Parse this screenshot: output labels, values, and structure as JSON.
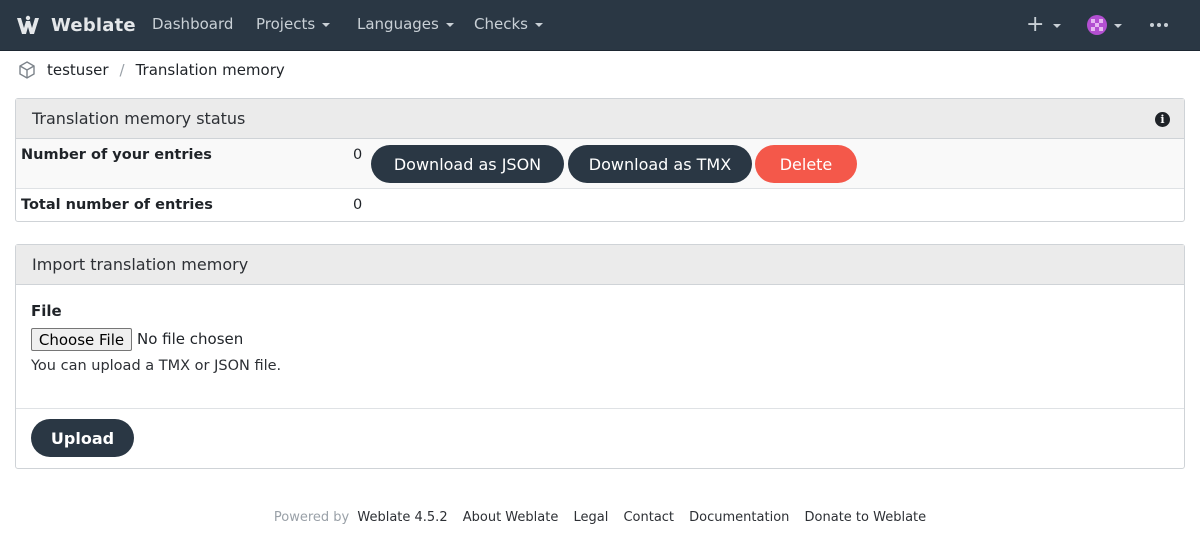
{
  "navbar": {
    "brand": "Weblate",
    "items": [
      {
        "label": "Dashboard",
        "dropdown": false
      },
      {
        "label": "Projects",
        "dropdown": true
      },
      {
        "label": "Languages",
        "dropdown": true
      },
      {
        "label": "Checks",
        "dropdown": true
      }
    ],
    "add_icon": "plus-icon",
    "avatar_color": "#b34fd1",
    "more_icon": "more-dots-icon",
    "background": "#2a3744"
  },
  "breadcrumb": {
    "user": "testuser",
    "separator": "/",
    "page": "Translation memory"
  },
  "status_panel": {
    "title": "Translation memory status",
    "info_icon": "info-icon",
    "rows": [
      {
        "label": "Number of your entries",
        "value": "0"
      },
      {
        "label": "Total number of entries",
        "value": "0"
      }
    ],
    "buttons": {
      "download_json": "Download as JSON",
      "download_tmx": "Download as TMX",
      "delete": "Delete"
    }
  },
  "import_panel": {
    "title": "Import translation memory",
    "file_label": "File",
    "choose_file": "Choose File",
    "no_file": "No file chosen",
    "help": "You can upload a TMX or JSON file.",
    "upload": "Upload"
  },
  "footer": {
    "powered_by": "Powered by",
    "links": [
      "Weblate 4.5.2",
      "About Weblate",
      "Legal",
      "Contact",
      "Documentation",
      "Donate to Weblate"
    ]
  },
  "colors": {
    "primary": "#2a3744",
    "danger": "#f4584a"
  }
}
